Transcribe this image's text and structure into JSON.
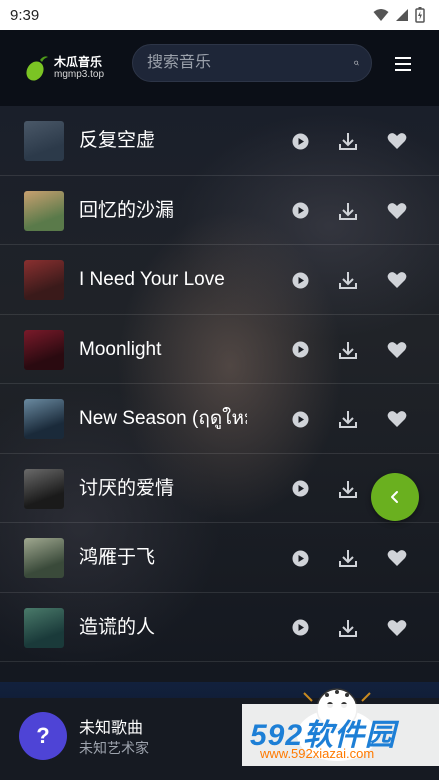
{
  "status_bar": {
    "time": "9:39"
  },
  "header": {
    "logo_name": "木瓜音乐",
    "logo_domain": "mgmp3.top",
    "search_placeholder": "搜索音乐"
  },
  "songs": [
    {
      "title": "反复空虚",
      "cover_colors": [
        "#2c3a4a",
        "#4a5868"
      ]
    },
    {
      "title": "回忆的沙漏",
      "cover_colors": [
        "#5a7a4a",
        "#c8a070"
      ]
    },
    {
      "title": "I Need Your Love",
      "cover_colors": [
        "#3a1a1a",
        "#8a3030"
      ]
    },
    {
      "title": "Moonlight",
      "cover_colors": [
        "#2a0a10",
        "#7a1a2a"
      ]
    },
    {
      "title": "New Season (ฤดูใหม่)",
      "cover_colors": [
        "#1a2a3a",
        "#6a8aa0"
      ]
    },
    {
      "title": "讨厌的爱情",
      "cover_colors": [
        "#1a1a1a",
        "#6a6a6a"
      ]
    },
    {
      "title": "鸿雁于飞",
      "cover_colors": [
        "#3a4a3a",
        "#a0a890"
      ]
    },
    {
      "title": "造谎的人",
      "cover_colors": [
        "#1a3a3a",
        "#4a7a6a"
      ]
    }
  ],
  "player": {
    "art_symbol": "?",
    "title": "未知歌曲",
    "artist": "未知艺术家"
  },
  "watermark": {
    "main": "592软件园",
    "url": "www.592xiazai.com"
  },
  "colors": {
    "accent_green": "#6ab01f",
    "player_art": "#4e44d6"
  }
}
